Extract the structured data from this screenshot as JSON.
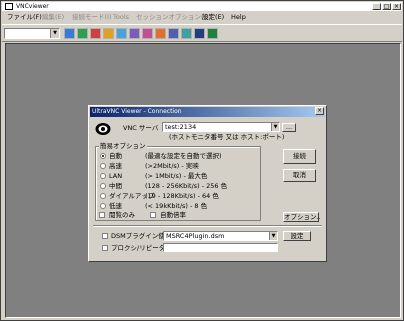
{
  "window": {
    "title": "VNCviewer"
  },
  "menu": [
    {
      "label": "ファイル(F)",
      "disabled": false
    },
    {
      "label": "編集(E)",
      "disabled": true
    },
    {
      "label": "接続モード(I)",
      "disabled": true
    },
    {
      "label": "Tools",
      "disabled": true
    },
    {
      "label": "セッションオプション(O)",
      "disabled": true
    },
    {
      "label": "設定(E)",
      "disabled": false
    },
    {
      "label": "Help",
      "disabled": false
    }
  ],
  "toolbar": {
    "combo_value": "",
    "buttons": [
      {
        "name": "new-connection-icon",
        "color": "#3a7bd5"
      },
      {
        "name": "connect-icon",
        "color": "#2e9f4f"
      },
      {
        "name": "disconnect-icon",
        "color": "#d04040"
      },
      {
        "name": "options-icon",
        "color": "#e0a020"
      },
      {
        "name": "refresh-icon",
        "color": "#4aa3d8"
      },
      {
        "name": "fullscreen-icon",
        "color": "#7a5cc0"
      },
      {
        "name": "transfer-icon",
        "color": "#c05090"
      },
      {
        "name": "chat-icon",
        "color": "#e07030"
      },
      {
        "name": "ctrl-alt-del-icon",
        "color": "#5060b0"
      },
      {
        "name": "clipboard-icon",
        "color": "#40a0a0"
      },
      {
        "name": "screen-icon",
        "color": "#204080"
      },
      {
        "name": "view-only-icon",
        "color": "#208040"
      }
    ]
  },
  "dialog": {
    "title": "UltraVNC Viewer - Connection",
    "server_label": "VNC サーバ",
    "server_value": "test:2134",
    "server_hint": "(ホストモニタ番号 又は ホスト:ポート)",
    "browse_label": "...",
    "quick_options_label": "簡易オプション",
    "options": [
      {
        "name": "自動",
        "desc": "(最適な設定を自動で選択)",
        "selected": true
      },
      {
        "name": "高速",
        "desc": "(>2Mbit/s) - 実映",
        "selected": false
      },
      {
        "name": "LAN",
        "desc": "(> 1Mbit/s) - 最大色",
        "selected": false
      },
      {
        "name": "中間",
        "desc": "(128 - 256Kbit/s) - 256 色",
        "selected": false
      },
      {
        "name": "ダイアルアップ",
        "desc": "(19 - 128Kbit/s) - 64 色",
        "selected": false
      },
      {
        "name": "低速",
        "desc": "(< 19kKbit/s) - 8 色",
        "selected": false
      }
    ],
    "view_only_label": "閲覧のみ",
    "auto_scale_label": "自動倍率",
    "connect_label": "接続",
    "cancel_label": "取消",
    "options_label": "オプション..",
    "dsm_label": "DSMプラグイン使用",
    "dsm_value": "MSRC4Plugin.dsm",
    "dsm_config_label": "設定",
    "proxy_label": "プロクシ/リピータ",
    "proxy_value": ""
  }
}
